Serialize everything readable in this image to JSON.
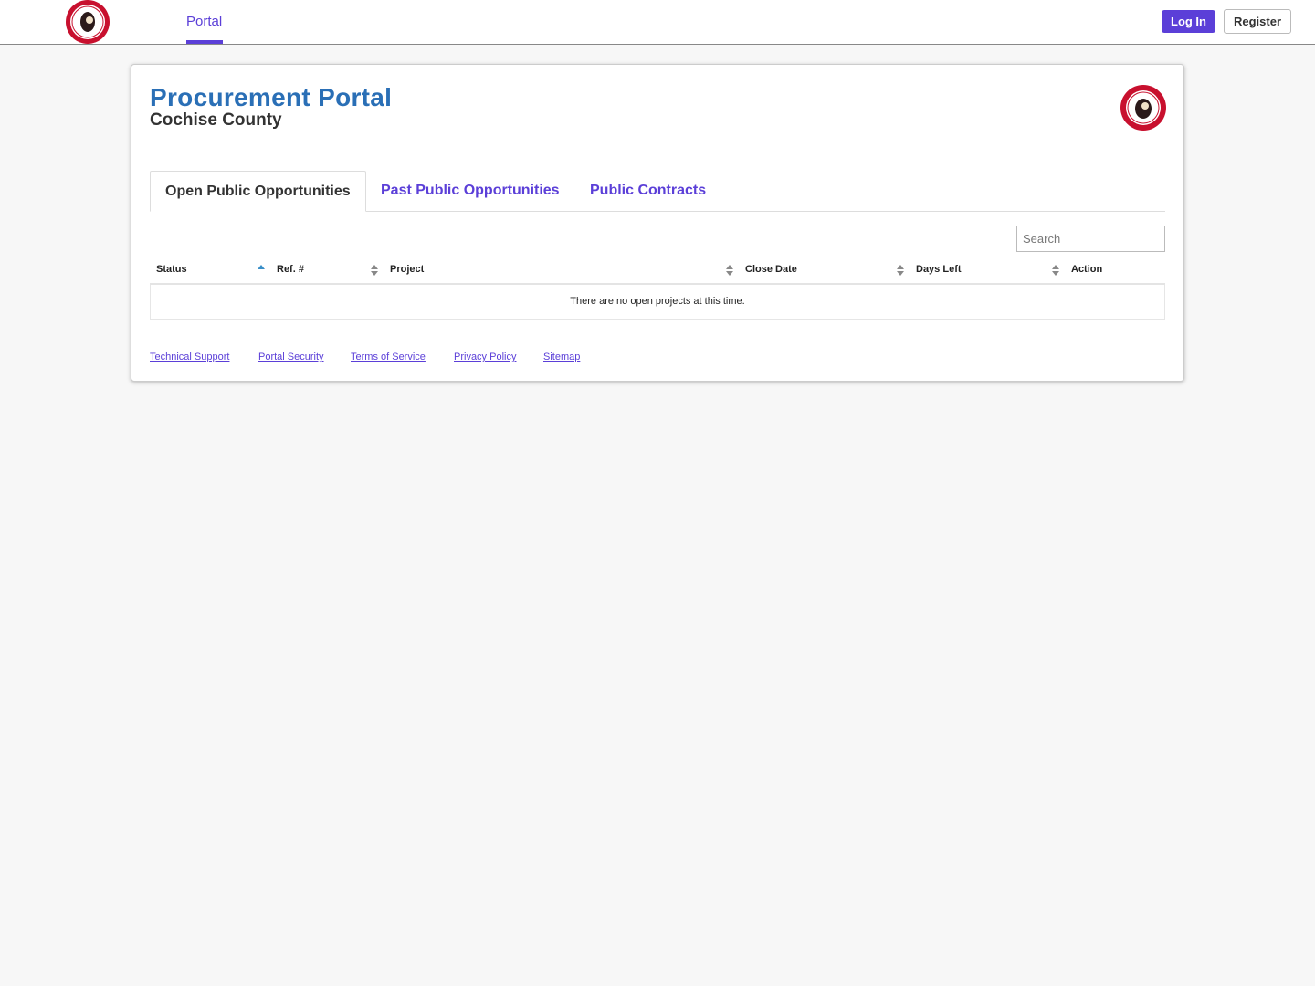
{
  "navbar": {
    "logo_icon": "county-seal-logo",
    "portal_link": "Portal",
    "login_label": "Log In",
    "register_label": "Register"
  },
  "header": {
    "title": "Procurement Portal",
    "subtitle": "Cochise County",
    "logo_icon": "county-seal-logo"
  },
  "tabs": [
    {
      "label": "Open Public Opportunities",
      "active": true
    },
    {
      "label": "Past Public Opportunities",
      "active": false
    },
    {
      "label": "Public Contracts",
      "active": false
    }
  ],
  "search": {
    "placeholder": "Search",
    "value": ""
  },
  "table": {
    "columns": [
      "Status",
      "Ref. #",
      "Project",
      "Close Date",
      "Days Left",
      "Action"
    ],
    "empty_message": "There are no open projects at this time."
  },
  "footer": {
    "links": [
      "Technical Support",
      "Portal Security",
      "Terms of Service",
      "Privacy Policy",
      "Sitemap"
    ]
  },
  "colors": {
    "accent": "#5b3fd8",
    "title_blue": "#2a6fb6",
    "seal_red": "#c8102e"
  }
}
